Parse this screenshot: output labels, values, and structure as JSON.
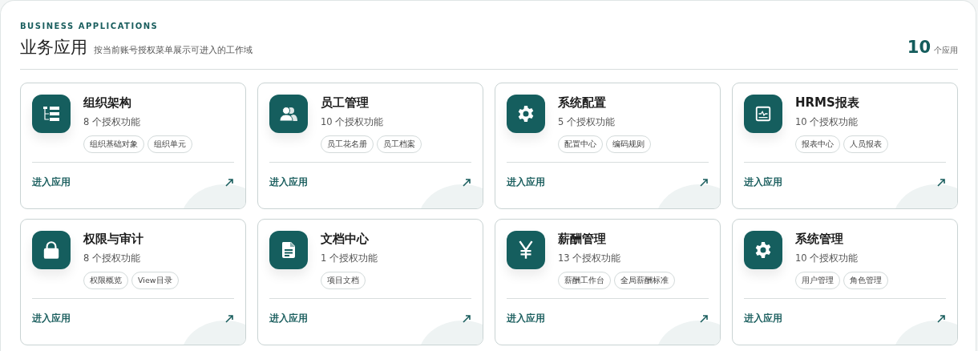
{
  "header": {
    "eyebrow": "BUSINESS APPLICATIONS",
    "title": "业务应用",
    "subtitle": "按当前账号授权菜单展示可进入的工作域",
    "count": "10",
    "count_unit": "个应用"
  },
  "apps": [
    {
      "kind": "tree",
      "name": "组织架构",
      "functions": "8 个授权功能",
      "tags": [
        "组织基础对象",
        "组织单元"
      ],
      "action": "进入应用"
    },
    {
      "kind": "people",
      "name": "员工管理",
      "functions": "10 个授权功能",
      "tags": [
        "员工花名册",
        "员工档案"
      ],
      "action": "进入应用"
    },
    {
      "kind": "gear",
      "name": "系统配置",
      "functions": "5 个授权功能",
      "tags": [
        "配置中心",
        "编码规则"
      ],
      "action": "进入应用"
    },
    {
      "kind": "chart",
      "name": "HRMS报表",
      "functions": "10 个授权功能",
      "tags": [
        "报表中心",
        "人员报表"
      ],
      "action": "进入应用"
    },
    {
      "kind": "lock",
      "name": "权限与审计",
      "functions": "8 个授权功能",
      "tags": [
        "权限概览",
        "View目录"
      ],
      "action": "进入应用"
    },
    {
      "kind": "document",
      "name": "文档中心",
      "functions": "1 个授权功能",
      "tags": [
        "项目文档"
      ],
      "action": "进入应用"
    },
    {
      "kind": "yen",
      "name": "薪酬管理",
      "functions": "13 个授权功能",
      "tags": [
        "薪酬工作台",
        "全局薪酬标准"
      ],
      "action": "进入应用"
    },
    {
      "kind": "gear",
      "name": "系统管理",
      "functions": "10 个授权功能",
      "tags": [
        "用户管理",
        "角色管理"
      ],
      "action": "进入应用"
    }
  ]
}
